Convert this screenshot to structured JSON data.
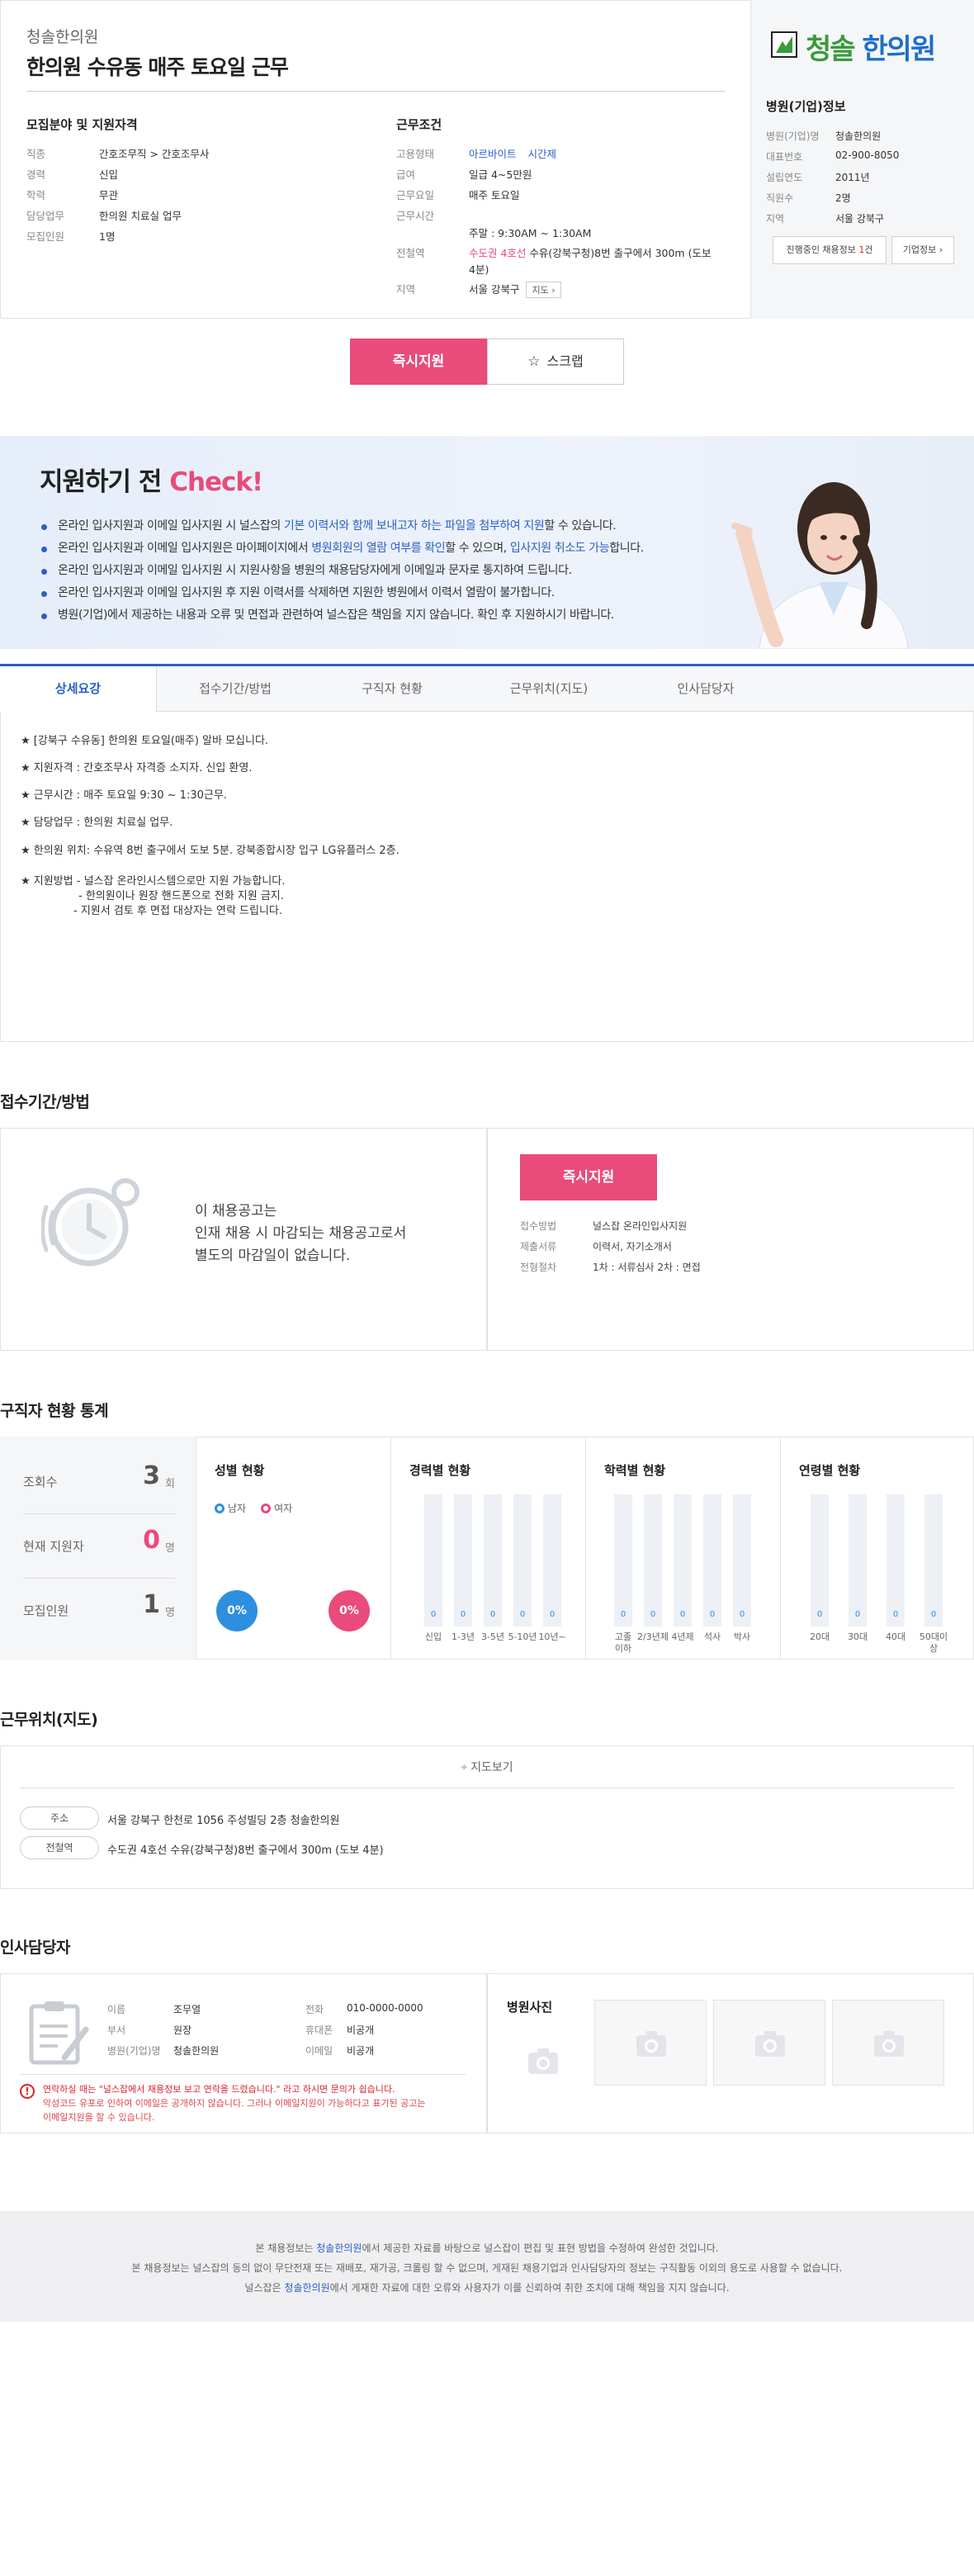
{
  "header": {
    "company": "청솔한의원",
    "title": "한의원 수유동 매주 토요일 근무"
  },
  "qualification": {
    "heading": "모집분야 및 지원자격",
    "rows": [
      {
        "k": "직종",
        "v": "간호조무직 > 간호조무사"
      },
      {
        "k": "경력",
        "v": "신입"
      },
      {
        "k": "학력",
        "v": "무관"
      },
      {
        "k": "담당업무",
        "v": "한의원 치료실 업무"
      },
      {
        "k": "모집인원",
        "v": "1명"
      }
    ]
  },
  "conditions": {
    "heading": "근무조건",
    "employment_label": "고용형태",
    "employment_values": [
      "아르바이트",
      "시간제"
    ],
    "pay_label": "급여",
    "pay": "일급 4~5만원",
    "day_label": "근무요일",
    "day": "매주 토요일",
    "time_label": "근무시간",
    "time": "주말 : 9:30AM ~ 1:30AM",
    "subway_label": "전철역",
    "subway_line": "수도권 4호선",
    "subway_rest": "수유(강북구청)8번 출구에서 300m (도보",
    "subway_rest2": "4분)",
    "area_label": "지역",
    "area": "서울 강북구",
    "map_btn": "지도"
  },
  "hospital": {
    "logo_green": "청솔",
    "logo_blue": "한의원",
    "heading": "병원(기업)정보",
    "rows": [
      {
        "k": "병원(기업)명",
        "v": "청솔한의원"
      },
      {
        "k": "대표번호",
        "v": "02-900-8050"
      },
      {
        "k": "설립연도",
        "v": "2011년"
      },
      {
        "k": "직원수",
        "v": "2명"
      },
      {
        "k": "지역",
        "v": "서울 강북구"
      }
    ],
    "jobs_btn_pre": "진행중인 채용정보 ",
    "jobs_btn_count": "1",
    "jobs_btn_post": "건",
    "info_btn": "기업정보"
  },
  "actions": {
    "apply": "즉시지원",
    "scrap": "스크랩"
  },
  "banner": {
    "title_pre": "지원하기 전 ",
    "title_check": "Check!",
    "items": [
      {
        "a": "온라인 입사지원과 이메일 입사지원 시 널스잡의 ",
        "b": "기본 이력서와 함께 보내고자 하는 파일을 첨부하여 지원",
        "c": "할 수 있습니다."
      },
      {
        "a": "온라인 입사지원과 이메일 입사지원은 마이페이지에서 ",
        "b": "병원회원의 열람 여부를 확인",
        "c": "할 수 있으며, ",
        "d": "입사지원 취소도 가능",
        "e": "합니다."
      },
      {
        "a": "온라인 입사지원과 이메일 입사지원 시 지원사항을 병원의 채용담당자에게 이메일과 문자로 통지하여 드립니다."
      },
      {
        "a": "온라인 입사지원과 이메일 입사지원 후 지원 이력서를 삭제하면 지원한 병원에서 이력서 열람이 불가합니다."
      },
      {
        "a": "병원(기업)에서 제공하는 내용과 오류 및 면접과 관련하여 널스잡은 책임을 지지 않습니다. 확인 후 지원하시기 바랍니다."
      }
    ]
  },
  "tabs": [
    "상세요강",
    "접수기간/방법",
    "구직자 현황",
    "근무위치(지도)",
    "인사담당자"
  ],
  "detail": {
    "lines": [
      "★ [강북구 수유동] 한의원 토요일(매주) 알바 모십니다.",
      "★ 지원자격 : 간호조무사 자격증 소지자. 신입 환영.",
      "★ 근무시간 : 매주 토요일 9:30 ~ 1:30근무.",
      "★ 담당업무 : 한의원 치료실 업무.",
      "★ 한의원 위치: 수유역 8번 출구에서 도보 5분. 강북종합시장 입구 LG유플러스 2층.",
      "★ 지원방법   - 널스잡 온라인시스템으로만 지원 가능합니다.",
      "- 한의원이나 원장 핸드폰으로 전화 지원 금지.",
      "- 지원서 검토 후 면접 대상자는 연락 드립니다."
    ]
  },
  "receipt": {
    "title": "접수기간/방법",
    "msg1": "이 채용공고는",
    "msg2": "인재 채용 시 마감되는 채용공고로서",
    "msg3": "별도의 마감일이 없습니다.",
    "apply": "즉시지원",
    "rows": [
      {
        "k": "접수방법",
        "v": "널스잡 온라인입사지원"
      },
      {
        "k": "제출서류",
        "v": "이력서, 자기소개서"
      },
      {
        "k": "전형절차",
        "v": "1차 : 서류심사   2차 : 면접"
      }
    ]
  },
  "stats": {
    "title": "구직자 현황 통계",
    "views_label": "조회수",
    "views": "3",
    "views_unit": "회",
    "applicants_label": "현재 지원자",
    "applicants": "0",
    "applicants_unit": "명",
    "recruit_label": "모집인원",
    "recruit": "1",
    "recruit_unit": "명",
    "gender_title": "성별 현황",
    "male": "남자",
    "female": "여자",
    "male_pct": "0%",
    "female_pct": "0%",
    "career_title": "경력별 현황",
    "career_labels": [
      "신입",
      "1-3년",
      "3-5년",
      "5-10년",
      "10년~"
    ],
    "career_values": [
      "0",
      "0",
      "0",
      "0",
      "0"
    ],
    "edu_title": "학력별 현황",
    "edu_labels": [
      "고졸\n이하",
      "2/3년제",
      "4년제",
      "석사",
      "박사"
    ],
    "edu_values": [
      "0",
      "0",
      "0",
      "0",
      "0"
    ],
    "age_title": "연령별 현황",
    "age_labels": [
      "20대",
      "30대",
      "40대",
      "50대이상"
    ],
    "age_values": [
      "0",
      "0",
      "0",
      "0"
    ],
    "bar_colors": {
      "bg": "#edf0f5",
      "value": "#2e8fe0",
      "male": "#2e8fe0",
      "female": "#e94b7b"
    }
  },
  "location": {
    "title": "근무위치(지도)",
    "map_btn": "지도보기",
    "addr_label": "주소",
    "addr": "서울 강북구 한천로 1056 주성빌딩 2층 청솔한의원",
    "subway_label": "전철역",
    "subway": "수도권 4호선 수유(강북구청)8번 출구에서 300m (도보 4분)"
  },
  "contact": {
    "title": "인사담당자",
    "name_label": "이름",
    "name": "조무열",
    "dept_label": "부서",
    "dept": "원장",
    "company_label": "병원(기업)명",
    "company": "청솔한의원",
    "phone_label": "전화",
    "phone": "010-0000-0000",
    "mobile_label": "휴대폰",
    "mobile": "비공개",
    "email_label": "이메일",
    "email": "비공개",
    "notice1": "연락하실 때는 \"널스잡에서 채용정보 보고 연락을 드렸습니다.\" 라고 하시면 문의가 쉽습니다.",
    "notice2": "악성코드 유포로 인하여 이메일은 공개하지 않습니다. 그러나 이메일지원이 가능하다고 표기된 공고는",
    "notice3": "이메일지원을 할 수 있습니다.",
    "photo_title": "병원사진"
  },
  "footer": {
    "l1_a": "본 채용정보는 ",
    "l1_b": "청솔한의원",
    "l1_c": "에서 제공한 자료를 바탕으로 널스잡이 편집 및 표현 방법을 수정하여 완성한 것입니다.",
    "l2": "본 채용정보는 널스잡의 동의 없이 무단전재 또는 재배포, 재가공, 크롤링 할 수 없으며, 게재된 채용기업과 인사담당자의 정보는 구직활동 이외의 용도로 사용할 수 없습니다.",
    "l3_a": "널스잡은 ",
    "l3_b": "청솔한의원",
    "l3_c": "에서 게재한 자료에 대한 오류와 사용자가 이를 신뢰하여 취한 조치에 대해 책임을 지지 않습니다."
  }
}
